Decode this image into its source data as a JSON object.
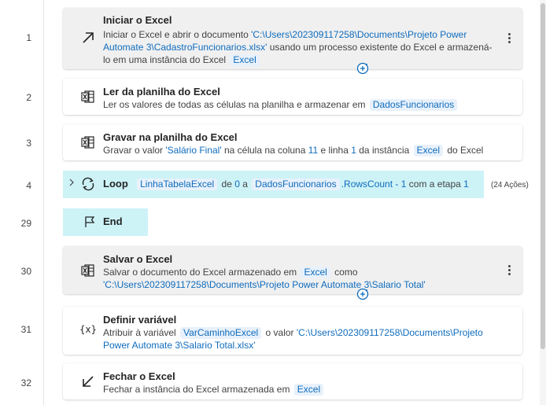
{
  "line_numbers": [
    "1",
    "2",
    "3",
    "4",
    "29",
    "30",
    "31",
    "32"
  ],
  "steps": {
    "iniciar": {
      "title": "Iniciar o Excel",
      "t1": "Iniciar o Excel e abrir o documento ",
      "path": "'C:\\Users\\202309117258\\Documents\\Projeto Power Automate 3\\CadastroFuncionarios.xlsx'",
      "t2": " usando um processo existente do Excel e armazená-lo em uma instância do Excel ",
      "var": "Excel"
    },
    "ler": {
      "title": "Ler da planilha do Excel",
      "t1": "Ler os valores de todas as células na planilha e armazenar em ",
      "var": "DadosFuncionarios"
    },
    "gravar": {
      "title": "Gravar na planilha do Excel",
      "t1": "Gravar o valor ",
      "value": "'Salário Final'",
      "t2": " na célula na coluna ",
      "col": "11",
      "t3": " e linha ",
      "row": "1",
      "t4": " da instância ",
      "var": "Excel",
      "t5": " do Excel"
    },
    "loop": {
      "title": "Loop",
      "var1": "LinhaTabelaExcel",
      "t1": "de",
      "from": "0",
      "t2": "a",
      "var2": "DadosFuncionarios",
      "prop": ".RowsCount",
      "minus": "- 1",
      "t3": "com a etapa",
      "step": "1",
      "count": "(24 Ações)"
    },
    "end": {
      "title": "End"
    },
    "salvar": {
      "title": "Salvar o Excel",
      "t1": "Salvar o documento do Excel armazenado em ",
      "var": "Excel",
      "t2": " como ",
      "path": "'C:\\Users\\202309117258\\Documents\\Projeto Power Automate 3\\Salario Total'"
    },
    "definir": {
      "title": "Definir variável",
      "t1": "Atribuir à variável ",
      "var": "VarCaminhoExcel",
      "t2": " o valor ",
      "value": "'C:\\Users\\202309117258\\Documents\\Projeto Power Automate 3\\Salario Total.xlsx'"
    },
    "fechar": {
      "title": "Fechar o Excel",
      "t1": "Fechar a instância do Excel armazenada em ",
      "var": "Excel"
    }
  },
  "icons": {
    "iniciar": "arrow-up-right-icon",
    "ler": "excel-icon",
    "gravar": "excel-icon",
    "loop": "loop-icon",
    "end": "flag-icon",
    "salvar": "excel-icon",
    "definir": "variable-icon",
    "fechar": "arrow-down-left-icon"
  },
  "colors": {
    "accent": "#0f6cbd",
    "loop_highlight": "#cdf3f7",
    "selected_card": "#f0f0f0"
  }
}
